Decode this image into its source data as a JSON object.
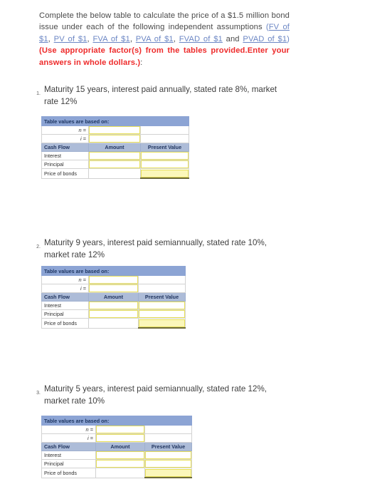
{
  "intro": {
    "line_start": "Complete the below table to calculate the price of a $1.5 million bond issue under each of the following independent assumptions ",
    "open_paren": "(",
    "links": [
      "FV of $1",
      "PV of $1",
      "FVA of $1",
      "PVA of $1",
      "FVAD of $1",
      "PVAD of $1"
    ],
    "sep": ", ",
    "and_text": " and ",
    "close_paren": ")",
    "emphasis": " (Use appropriate factor(s) from the tables provided.Enter your answers in whole dollars.)",
    "tail_colon": ":",
    "link_color": "#6b86c4",
    "emphasis_color": "#ee2b2b"
  },
  "table_labels": {
    "basis_header": "Table values are based on:",
    "n_label": "n =",
    "i_label": "i =",
    "col_cash_flow": "Cash Flow",
    "col_amount": "Amount",
    "col_present_value": "Present Value",
    "row_interest": "Interest",
    "row_principal": "Principal",
    "row_price": "Price of bonds"
  },
  "questions": [
    {
      "number": "1.",
      "text": "Maturity 15 years, interest paid annually, stated rate 8%, market rate 12%",
      "n_value": "",
      "i_value": "",
      "interest_amount": "",
      "interest_pv": "",
      "principal_amount": "",
      "principal_pv": "",
      "price_of_bonds": ""
    },
    {
      "number": "2.",
      "text": "Maturity 9 years, interest paid semiannually, stated rate 10%, market rate 12%",
      "n_value": "",
      "i_value": "",
      "interest_amount": "",
      "interest_pv": "",
      "principal_amount": "",
      "principal_pv": "",
      "price_of_bonds": ""
    },
    {
      "number": "3.",
      "text": "Maturity 5 years, interest paid semiannually, stated rate 12%, market rate 10%",
      "n_value": "",
      "i_value": "",
      "interest_amount": "",
      "interest_pv": "",
      "principal_amount": "",
      "principal_pv": "",
      "price_of_bonds": ""
    }
  ],
  "colors": {
    "header_blue": "#8ca4d4",
    "subheader_blue": "#adbcd8",
    "input_border_yellow": "#e8e05a",
    "filled_yellow": "#fbf7ba"
  }
}
